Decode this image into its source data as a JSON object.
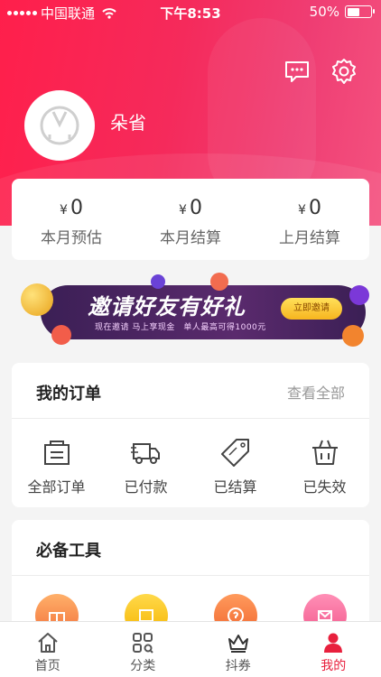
{
  "status_bar": {
    "carrier": "中国联通",
    "time": "下午8:53",
    "battery": "50%",
    "battery_level": 0.5
  },
  "header": {
    "username": "朵省",
    "icons": [
      "chat-icon",
      "gear-icon"
    ]
  },
  "stats": [
    {
      "currency": "¥",
      "value": "0",
      "label": "本月预估"
    },
    {
      "currency": "¥",
      "value": "0",
      "label": "本月结算"
    },
    {
      "currency": "¥",
      "value": "0",
      "label": "上月结算"
    }
  ],
  "banner": {
    "title": "邀请好友有好礼",
    "subtitle": "现在邀请 马上享现金　单人最高可得1000元",
    "cta": "立即邀请"
  },
  "orders": {
    "title": "我的订单",
    "view_all": "查看全部",
    "items": [
      {
        "label": "全部订单",
        "icon": "bag-icon"
      },
      {
        "label": "已付款",
        "icon": "truck-icon"
      },
      {
        "label": "已结算",
        "icon": "tag-icon"
      },
      {
        "label": "已失效",
        "icon": "basket-icon"
      }
    ]
  },
  "tools": {
    "title": "必备工具"
  },
  "tabbar": [
    {
      "label": "首页",
      "icon": "home-icon"
    },
    {
      "label": "分类",
      "icon": "grid-icon"
    },
    {
      "label": "抖券",
      "icon": "crown-icon"
    },
    {
      "label": "我的",
      "icon": "user-icon",
      "active": true
    }
  ],
  "colors": {
    "accent": "#e8203d",
    "hero": "#ff1f4b"
  }
}
